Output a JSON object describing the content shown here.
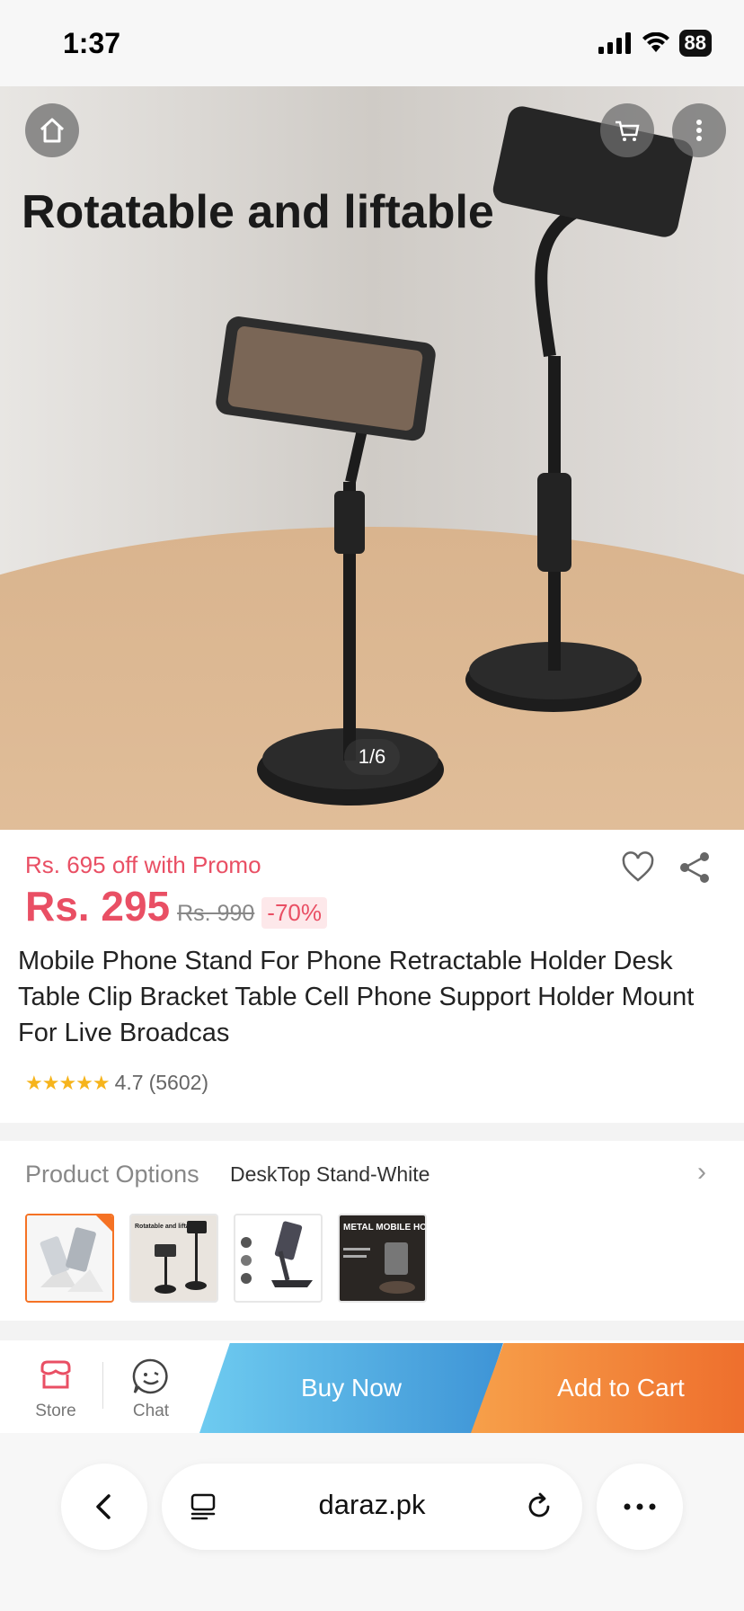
{
  "status_bar": {
    "time": "1:37",
    "battery": "88"
  },
  "hero": {
    "caption": "Rotatable and liftable",
    "pager": "1/6",
    "buttons": [
      "home-icon",
      "cart-icon",
      "more-icon"
    ]
  },
  "product": {
    "promo": "Rs. 695 off with Promo",
    "price": "Rs. 295",
    "original_price": "Rs. 990",
    "discount": "-70%",
    "title": "Mobile Phone Stand For Phone Retractable Holder Desk Table Clip Bracket Table Cell Phone Support Holder Mount For Live Broadcas",
    "rating": "4.7",
    "reviews": "(5602)",
    "stars": "★★★★★"
  },
  "options": {
    "label": "Product Options",
    "value": "DeskTop Stand-White",
    "chevron": "›",
    "thumb2_caption": "Rotatable and liftable",
    "thumb4_title": "METAL MOBILE HOLDER"
  },
  "action_bar": {
    "store_label": "Store",
    "chat_label": "Chat",
    "buy_now": "Buy Now",
    "add_to_cart": "Add to Cart"
  },
  "browser": {
    "url": "daraz.pk"
  },
  "colors": {
    "accent": "#e94f64",
    "orange": "#f57224",
    "blue": "#3e94d6"
  }
}
